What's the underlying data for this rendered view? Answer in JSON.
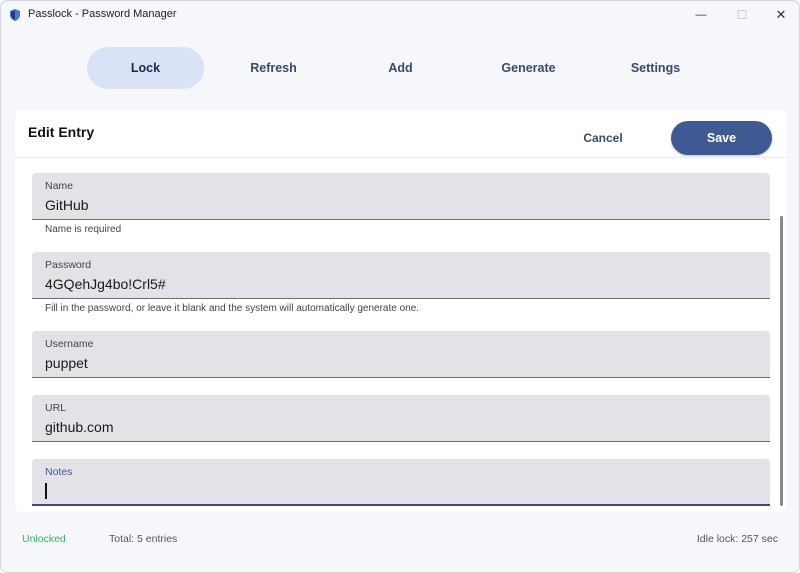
{
  "window": {
    "title": "Passlock - Password Manager",
    "minimize_glyph": "—",
    "maximize_glyph": "☐",
    "close_glyph": "✕"
  },
  "toolbar": {
    "lock_label": "Lock",
    "refresh_label": "Refresh",
    "add_label": "Add",
    "generate_label": "Generate",
    "settings_label": "Settings"
  },
  "editor": {
    "title": "Edit Entry",
    "cancel_label": "Cancel",
    "save_label": "Save",
    "fields": {
      "name": {
        "label": "Name",
        "value": "GitHub",
        "helper": "Name is required"
      },
      "password": {
        "label": "Password",
        "value": "4GQehJg4bo!Crl5#",
        "helper": "Fill in the password, or leave it blank and the system will automatically generate one."
      },
      "username": {
        "label": "Username",
        "value": "puppet"
      },
      "url": {
        "label": "URL",
        "value": "github.com"
      },
      "notes": {
        "label": "Notes",
        "value": ""
      }
    }
  },
  "status": {
    "state": "Unlocked",
    "total": "Total: 5 entries",
    "idle_lock": "Idle lock: 257 sec"
  },
  "colors": {
    "accent": "#3f5a92",
    "active_tab": "#dae2f8",
    "unlocked": "#3ab06a"
  }
}
